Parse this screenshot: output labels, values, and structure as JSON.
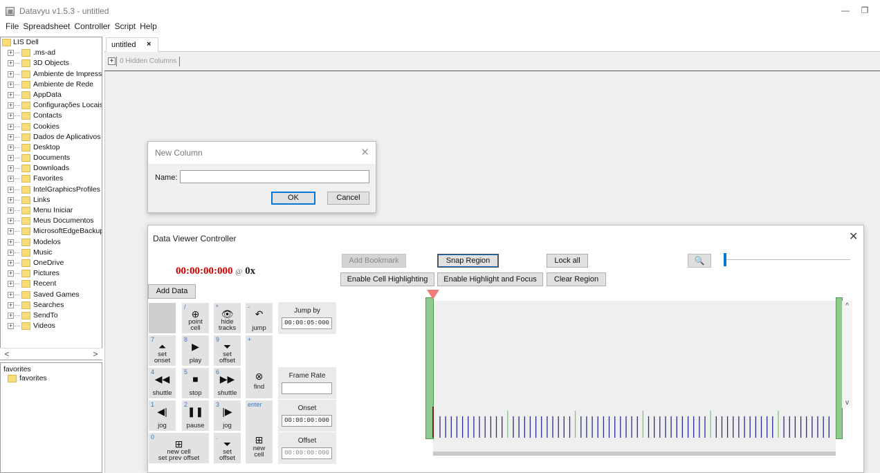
{
  "window": {
    "title": "Datavyu v1.5.3 - untitled",
    "minimize": "—",
    "restore": "❐"
  },
  "menu": [
    "File",
    "Spreadsheet",
    "Controller",
    "Script",
    "Help"
  ],
  "tree": {
    "root": "LIS Dell",
    "items": [
      ".ms-ad",
      "3D Objects",
      "Ambiente de Impressã",
      "Ambiente de Rede",
      "AppData",
      "Configurações Locais",
      "Contacts",
      "Cookies",
      "Dados de Aplicativos",
      "Desktop",
      "Documents",
      "Downloads",
      "Favorites",
      "IntelGraphicsProfiles",
      "Links",
      "Menu Iniciar",
      "Meus Documentos",
      "MicrosoftEdgeBackups",
      "Modelos",
      "Music",
      "OneDrive",
      "Pictures",
      "Recent",
      "Saved Games",
      "Searches",
      "SendTo",
      "Videos"
    ],
    "scroll_left": "<",
    "scroll_right": ">"
  },
  "favorites": {
    "header": "favorites",
    "items": [
      "favorites"
    ]
  },
  "spreadsheet": {
    "tab_label": "untitled",
    "tab_close": "×",
    "hidden_plus": "+",
    "hidden_columns": "0 Hidden Columns"
  },
  "new_column_dialog": {
    "title": "New Column",
    "close": "✕",
    "name_label": "Name:",
    "name_value": "",
    "ok": "OK",
    "cancel": "Cancel"
  },
  "controller": {
    "title": "Data Viewer Controller",
    "close": "✕",
    "time": "00:00:00:000",
    "at": "@",
    "speed": "0x",
    "add_data": "Add Data",
    "add_bookmark": "Add Bookmark",
    "snap_region": "Snap Region",
    "lock_all": "Lock all",
    "enable_cell_highlighting": "Enable Cell Highlighting",
    "enable_highlight_focus": "Enable Highlight and Focus",
    "clear_region": "Clear Region",
    "zoom_icon": "🔍",
    "keys": {
      "point_cell": {
        "num": "/",
        "label": "point\ncell",
        "icon": "⊕"
      },
      "hide_tracks": {
        "num": "*",
        "label": "hide\ntracks",
        "icon": "👁"
      },
      "jump": {
        "num": "-",
        "label": "jump",
        "icon": "↶"
      },
      "set_onset": {
        "num": "7",
        "label": "set\nonset",
        "icon": "⏶"
      },
      "play": {
        "num": "8",
        "label": "play",
        "icon": "▶"
      },
      "set_offset_top": {
        "num": "9",
        "label": "set\noffset",
        "icon": "⏷"
      },
      "plus_num": "+",
      "find": {
        "label": "find",
        "icon": "⊗"
      },
      "shuttle_back": {
        "num": "4",
        "label": "shuttle",
        "icon": "◀◀"
      },
      "stop": {
        "num": "5",
        "label": "stop",
        "icon": "■"
      },
      "shuttle_fwd": {
        "num": "6",
        "label": "shuttle",
        "icon": "▶▶"
      },
      "jog_back": {
        "num": "1",
        "label": "jog",
        "icon": "◀|"
      },
      "pause": {
        "num": "2",
        "label": "pause",
        "icon": "❚❚"
      },
      "jog_fwd": {
        "num": "3",
        "label": "jog",
        "icon": "|▶"
      },
      "enter_num": "enter",
      "new_cell_prev": {
        "num": "0",
        "label": "new cell\nset prev offset",
        "icon": "⊞"
      },
      "set_offset_bottom": {
        "num": ".",
        "label": "set\noffset",
        "icon": "⏷"
      },
      "new_cell": {
        "label": "new\ncell",
        "icon": "⊞"
      }
    },
    "jump_by": {
      "label": "Jump by",
      "value": "00:00:05:000"
    },
    "frame_rate": {
      "label": "Frame Rate",
      "value": ""
    },
    "onset": {
      "label": "Onset",
      "value": "00:00:00:000"
    },
    "offset": {
      "label": "Offset",
      "value": "00:00:00:000"
    },
    "timeline_scroll_up": "^",
    "timeline_scroll_down": "v",
    "zoom_level": 0
  }
}
